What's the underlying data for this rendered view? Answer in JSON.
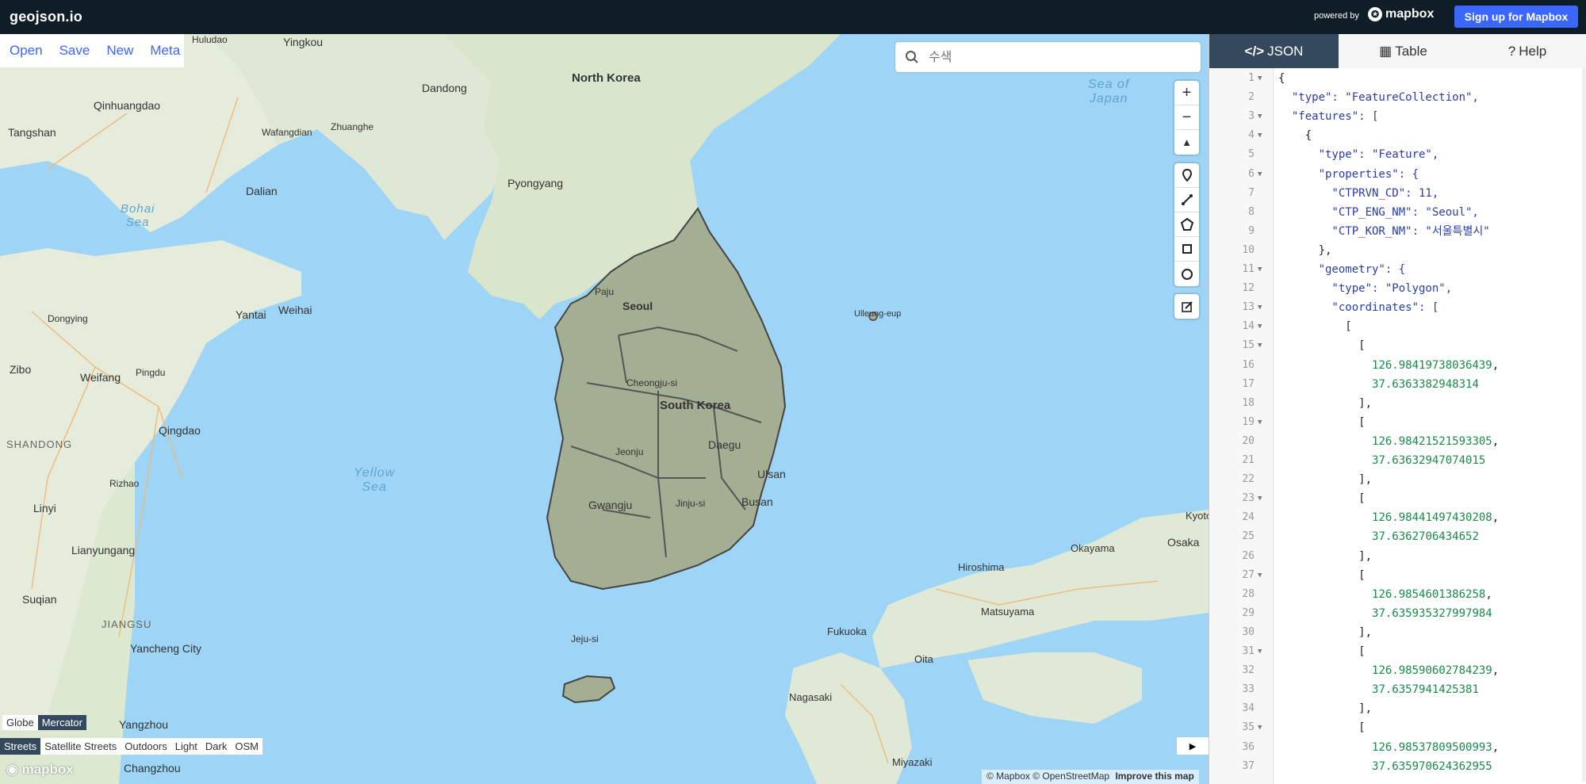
{
  "app": {
    "title": "geojson.io",
    "powered_by": "powered by",
    "brand": "mapbox",
    "signup": "Sign up for Mapbox"
  },
  "file_menu": [
    "Open",
    "Save",
    "New",
    "Meta"
  ],
  "search": {
    "placeholder": "수색"
  },
  "map_labels": {
    "north_korea": "North Korea",
    "south_korea": "South Korea",
    "seoul": "Seoul",
    "pyongyang": "Pyongyang",
    "dandong": "Dandong",
    "yingkou": "Yingkou",
    "dalian": "Dalian",
    "zhuanghe": "Zhuanghe",
    "wafangdian": "Wafangdian",
    "qinhuangdao": "Qinhuangdao",
    "tangshan": "Tangshan",
    "huludao": "Huludao",
    "dongying": "Dongying",
    "yantai": "Yantai",
    "weihai": "Weihai",
    "zibo": "Zibo",
    "weifang": "Weifang",
    "pingdu": "Pingdu",
    "qingdao": "Qingdao",
    "shandong": "SHANDONG",
    "rizhao": "Rizhao",
    "linyi": "Linyi",
    "lianyungang": "Lianyungang",
    "suqian": "Suqian",
    "jiangsu": "JIANGSU",
    "yancheng": "Yancheng City",
    "yangzhou": "Yangzhou",
    "changzhou": "Changzhou",
    "paju": "Paju",
    "cheongju": "Cheongju-si",
    "jeonju": "Jeonju",
    "daegu": "Daegu",
    "ulsan": "Ulsan",
    "busan": "Busan",
    "gwangju": "Gwangju",
    "jinju": "Jinju-si",
    "jeju": "Jeju-si",
    "ulleung": "Ulleung-eup",
    "hiroshima": "Hiroshima",
    "okayama": "Okayama",
    "osaka": "Osaka",
    "kyoto": "Kyoto",
    "matsuyama": "Matsuyama",
    "fukuoka": "Fukuoka",
    "oita": "Oita",
    "nagasaki": "Nagasaki",
    "miyazaki": "Miyazaki"
  },
  "sea_labels": {
    "bohai": "Bohai\nSea",
    "yellow": "Yellow\nSea",
    "japan": "Sea of\nJapan"
  },
  "map_controls": {
    "zoom_in": "+",
    "zoom_out": "−",
    "compass": "▲",
    "draw_tools": [
      "marker-icon",
      "line-icon",
      "polygon-icon",
      "rectangle-icon",
      "circle-icon"
    ],
    "edit": "edit-icon"
  },
  "projection": {
    "options": [
      "Globe",
      "Mercator"
    ],
    "active": "Mercator"
  },
  "styles": {
    "options": [
      "Streets",
      "Satellite Streets",
      "Outdoors",
      "Light",
      "Dark",
      "OSM"
    ],
    "active": "Streets"
  },
  "watermark": "mapbox",
  "attribution": {
    "mapbox": "© Mapbox",
    "osm": "© OpenStreetMap",
    "improve": "Improve this map"
  },
  "tabs": [
    {
      "label": "JSON",
      "icon": "code-icon",
      "active": true
    },
    {
      "label": "Table",
      "icon": "table-icon",
      "active": false
    },
    {
      "label": "Help",
      "icon": "question-icon",
      "active": false
    }
  ],
  "json_lines": [
    {
      "n": "1",
      "fold": true,
      "text": "{"
    },
    {
      "n": "2",
      "fold": false,
      "text": "  \"type\": \"FeatureCollection\","
    },
    {
      "n": "3",
      "fold": true,
      "text": "  \"features\": ["
    },
    {
      "n": "4",
      "fold": true,
      "text": "    {"
    },
    {
      "n": "5",
      "fold": false,
      "text": "      \"type\": \"Feature\","
    },
    {
      "n": "6",
      "fold": true,
      "text": "      \"properties\": {"
    },
    {
      "n": "7",
      "fold": false,
      "text": "        \"CTPRVN_CD\": 11,"
    },
    {
      "n": "8",
      "fold": false,
      "text": "        \"CTP_ENG_NM\": \"Seoul\","
    },
    {
      "n": "9",
      "fold": false,
      "text": "        \"CTP_KOR_NM\": \"서울특별시\""
    },
    {
      "n": "10",
      "fold": false,
      "text": "      },"
    },
    {
      "n": "11",
      "fold": true,
      "text": "      \"geometry\": {"
    },
    {
      "n": "12",
      "fold": false,
      "text": "        \"type\": \"Polygon\","
    },
    {
      "n": "13",
      "fold": true,
      "text": "        \"coordinates\": ["
    },
    {
      "n": "14",
      "fold": true,
      "text": "          ["
    },
    {
      "n": "15",
      "fold": true,
      "text": "            ["
    },
    {
      "n": "16",
      "fold": false,
      "text": "              126.98419738036439,"
    },
    {
      "n": "17",
      "fold": false,
      "text": "              37.6363382948314"
    },
    {
      "n": "18",
      "fold": false,
      "text": "            ],"
    },
    {
      "n": "19",
      "fold": true,
      "text": "            ["
    },
    {
      "n": "20",
      "fold": false,
      "text": "              126.98421521593305,"
    },
    {
      "n": "21",
      "fold": false,
      "text": "              37.63632947074015"
    },
    {
      "n": "22",
      "fold": false,
      "text": "            ],"
    },
    {
      "n": "23",
      "fold": true,
      "text": "            ["
    },
    {
      "n": "24",
      "fold": false,
      "text": "              126.98441497430208,"
    },
    {
      "n": "25",
      "fold": false,
      "text": "              37.6362706434652"
    },
    {
      "n": "26",
      "fold": false,
      "text": "            ],"
    },
    {
      "n": "27",
      "fold": true,
      "text": "            ["
    },
    {
      "n": "28",
      "fold": false,
      "text": "              126.9854601386258,"
    },
    {
      "n": "29",
      "fold": false,
      "text": "              37.635935327997984"
    },
    {
      "n": "30",
      "fold": false,
      "text": "            ],"
    },
    {
      "n": "31",
      "fold": true,
      "text": "            ["
    },
    {
      "n": "32",
      "fold": false,
      "text": "              126.98590602784239,"
    },
    {
      "n": "33",
      "fold": false,
      "text": "              37.6357941425381"
    },
    {
      "n": "34",
      "fold": false,
      "text": "            ],"
    },
    {
      "n": "35",
      "fold": true,
      "text": "            ["
    },
    {
      "n": "36",
      "fold": false,
      "text": "              126.98537809500993,"
    },
    {
      "n": "37",
      "fold": false,
      "text": "              37.635970624362955"
    }
  ]
}
